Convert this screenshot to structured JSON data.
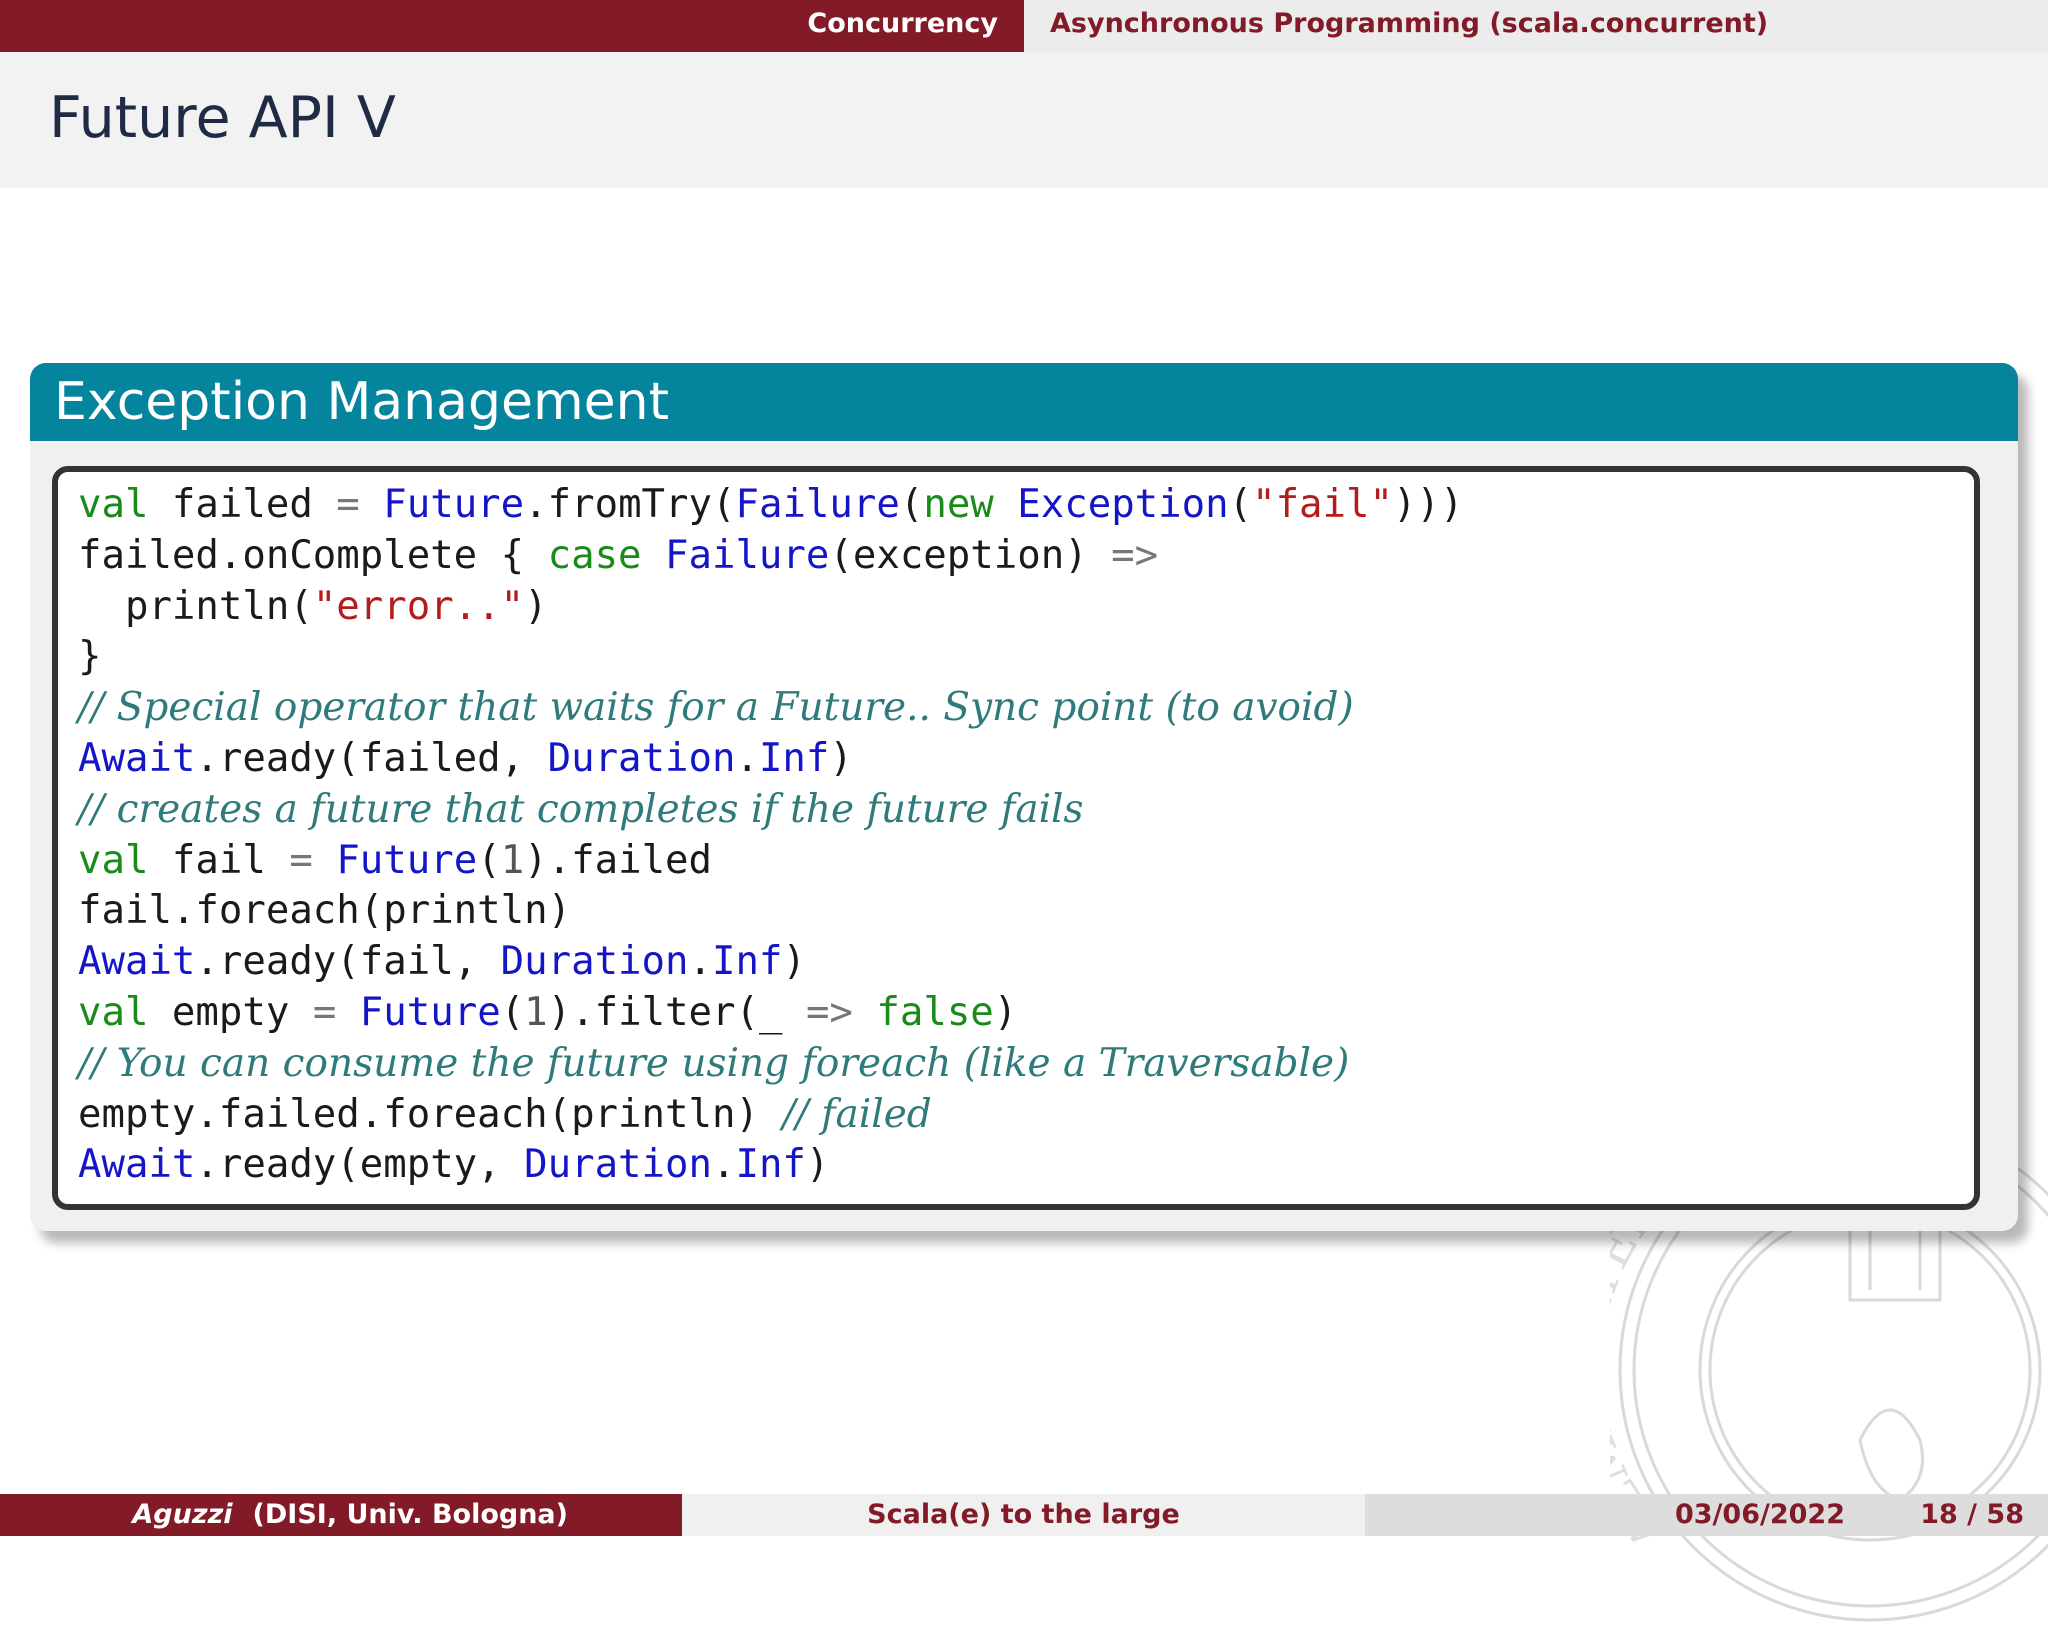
{
  "header": {
    "section": "Concurrency",
    "subsection": "Asynchronous Programming (scala.concurrent)"
  },
  "frame": {
    "title": "Future API V"
  },
  "block": {
    "title": "Exception Management",
    "code_lines": [
      [
        [
          "kw",
          "val"
        ],
        [
          "pl",
          " failed "
        ],
        [
          "op",
          "="
        ],
        [
          "pl",
          " "
        ],
        [
          "ty",
          "Future"
        ],
        [
          "pl",
          ".fromTry("
        ],
        [
          "ty",
          "Failure"
        ],
        [
          "pl",
          "("
        ],
        [
          "kw",
          "new"
        ],
        [
          "pl",
          " "
        ],
        [
          "ty",
          "Exception"
        ],
        [
          "pl",
          "("
        ],
        [
          "str",
          "\"fail\""
        ],
        [
          "pl",
          ")))"
        ]
      ],
      [
        [
          "pl",
          "failed.onComplete { "
        ],
        [
          "kw",
          "case"
        ],
        [
          "pl",
          " "
        ],
        [
          "ty",
          "Failure"
        ],
        [
          "pl",
          "(exception) "
        ],
        [
          "op",
          "=>"
        ]
      ],
      [
        [
          "pl",
          "  println("
        ],
        [
          "str",
          "\"error..\""
        ],
        [
          "pl",
          ")"
        ]
      ],
      [
        [
          "pl",
          "}"
        ]
      ],
      [
        [
          "cm",
          "// Special operator that waits for a Future.. Sync point (to avoid)"
        ]
      ],
      [
        [
          "ty",
          "Await"
        ],
        [
          "pl",
          ".ready(failed, "
        ],
        [
          "ty",
          "Duration"
        ],
        [
          "pl",
          "."
        ],
        [
          "ty",
          "Inf"
        ],
        [
          "pl",
          ")"
        ]
      ],
      [
        [
          "cm",
          "// creates a future that completes if the future fails"
        ]
      ],
      [
        [
          "kw",
          "val"
        ],
        [
          "pl",
          " fail "
        ],
        [
          "op",
          "="
        ],
        [
          "pl",
          " "
        ],
        [
          "ty",
          "Future"
        ],
        [
          "pl",
          "("
        ],
        [
          "num",
          "1"
        ],
        [
          "pl",
          ").failed"
        ]
      ],
      [
        [
          "pl",
          "fail.foreach(println)"
        ]
      ],
      [
        [
          "ty",
          "Await"
        ],
        [
          "pl",
          ".ready(fail, "
        ],
        [
          "ty",
          "Duration"
        ],
        [
          "pl",
          "."
        ],
        [
          "ty",
          "Inf"
        ],
        [
          "pl",
          ")"
        ]
      ],
      [
        [
          "kw",
          "val"
        ],
        [
          "pl",
          " empty "
        ],
        [
          "op",
          "="
        ],
        [
          "pl",
          " "
        ],
        [
          "ty",
          "Future"
        ],
        [
          "pl",
          "("
        ],
        [
          "num",
          "1"
        ],
        [
          "pl",
          ").filter(_ "
        ],
        [
          "op",
          "=>"
        ],
        [
          "pl",
          " "
        ],
        [
          "kw",
          "false"
        ],
        [
          "pl",
          ")"
        ]
      ],
      [
        [
          "cm",
          "// You can consume the future using foreach (like a Traversable)"
        ]
      ],
      [
        [
          "pl",
          "empty.failed.foreach(println) "
        ],
        [
          "cm",
          "// failed"
        ]
      ],
      [
        [
          "ty",
          "Await"
        ],
        [
          "pl",
          ".ready(empty, "
        ],
        [
          "ty",
          "Duration"
        ],
        [
          "pl",
          "."
        ],
        [
          "ty",
          "Inf"
        ],
        [
          "pl",
          ")"
        ]
      ]
    ]
  },
  "watermark": {
    "seal_text": "ALMA MATER STUDIORUM UNIVERSITAS BONONIENSIS"
  },
  "footer": {
    "author": "Aguzzi",
    "affiliation": "(DISI, Univ. Bologna)",
    "talk_title": "Scala(e) to the large",
    "date": "03/06/2022",
    "page": "18 / 58"
  },
  "colors": {
    "brand_red": "#831a27",
    "block_teal": "#04859d",
    "keyword_green": "#1a8a1a",
    "type_blue": "#1515c8",
    "string_red": "#b31c1c",
    "comment_teal": "#2f7a7a"
  }
}
